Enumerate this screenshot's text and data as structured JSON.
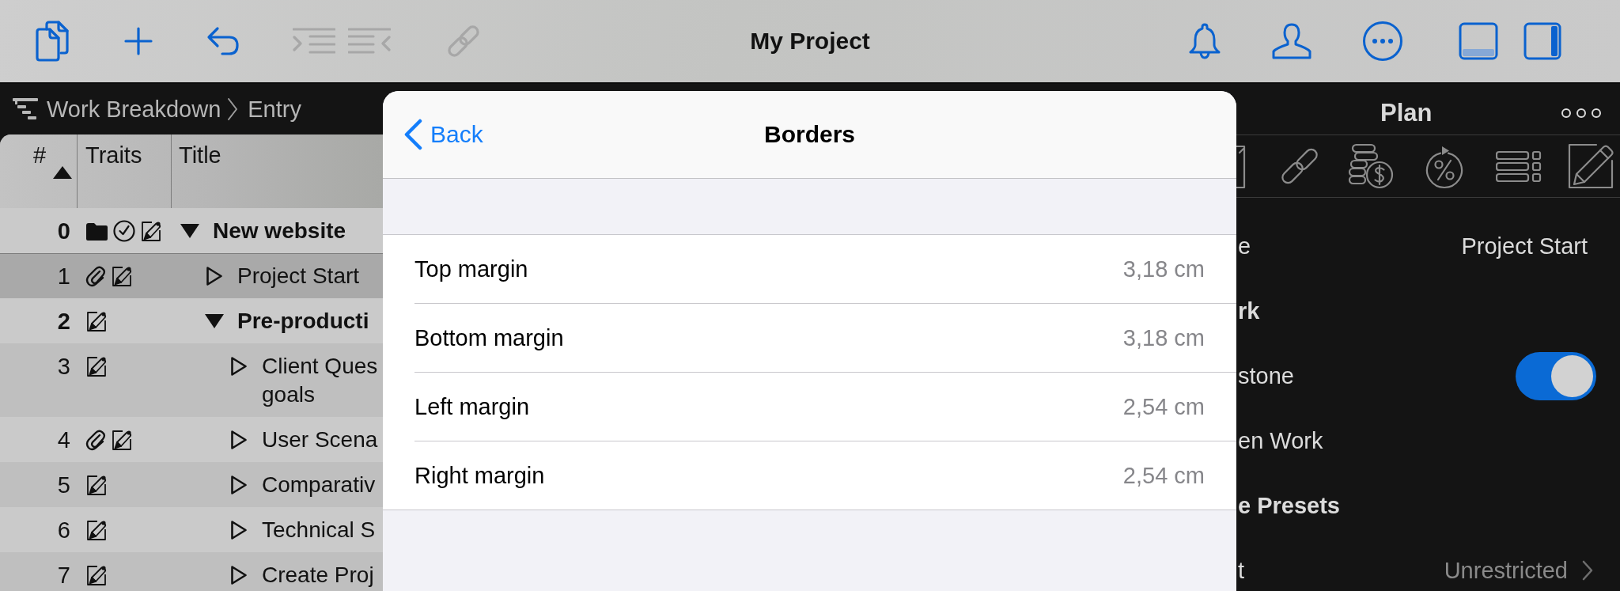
{
  "toolbar": {
    "left_buttons": [
      {
        "kind": "duplicate",
        "disabled": false
      },
      {
        "kind": "add",
        "disabled": false
      },
      {
        "kind": "undo",
        "disabled": false
      },
      {
        "kind": "indent",
        "disabled": true
      },
      {
        "kind": "outdent",
        "disabled": true
      },
      {
        "kind": "link",
        "disabled": true
      }
    ],
    "title": "My Project",
    "right_buttons": [
      {
        "kind": "notifications"
      },
      {
        "kind": "account"
      },
      {
        "kind": "more"
      }
    ],
    "view_toggles": [
      {
        "kind": "bottom_pane",
        "on": false
      },
      {
        "kind": "sidebar",
        "on": true
      }
    ]
  },
  "breadcrumb": [
    "Work Breakdown",
    "Entry"
  ],
  "table": {
    "columns": [
      {
        "label": "#",
        "sorted": true
      },
      {
        "label": "Traits",
        "sorted": false
      },
      {
        "label": "Title",
        "sorted": false
      }
    ],
    "rows": [
      {
        "number": "0",
        "title": "New website",
        "expanded": true,
        "selected": false,
        "traits": {
          "folder": true,
          "check": true,
          "attachment": false,
          "note": true
        },
        "children": [
          {
            "number": "1",
            "title": "Project Start",
            "expanded": false,
            "selected": true,
            "traits": {
              "folder": false,
              "check": false,
              "attachment": true,
              "note": true
            }
          },
          {
            "number": "2",
            "title": "Pre-producti",
            "expanded": true,
            "selected": false,
            "traits": {
              "folder": false,
              "check": false,
              "attachment": false,
              "note": true
            },
            "children": [
              {
                "number": "3",
                "title": "Client Ques\ngoals",
                "expanded": false,
                "selected": false,
                "traits": {
                  "folder": false,
                  "check": false,
                  "attachment": false,
                  "note": true
                }
              },
              {
                "number": "4",
                "title": "User Scena",
                "expanded": false,
                "selected": false,
                "traits": {
                  "folder": false,
                  "check": false,
                  "attachment": true,
                  "note": true
                }
              },
              {
                "number": "5",
                "title": "Comparativ",
                "expanded": false,
                "selected": false,
                "traits": {
                  "folder": false,
                  "check": false,
                  "attachment": false,
                  "note": true
                }
              },
              {
                "number": "6",
                "title": "Technical S",
                "expanded": false,
                "selected": false,
                "traits": {
                  "folder": false,
                  "check": false,
                  "attachment": false,
                  "note": true
                }
              },
              {
                "number": "7",
                "title": "Create Proj",
                "expanded": false,
                "selected": false,
                "traits": {
                  "folder": false,
                  "check": false,
                  "attachment": false,
                  "note": true
                }
              }
            ]
          }
        ]
      }
    ]
  },
  "dialog": {
    "back": "Back",
    "title": "Borders",
    "rows": [
      {
        "label": "Top margin",
        "value": "3,18 cm"
      },
      {
        "label": "Bottom margin",
        "value": "3,18 cm"
      },
      {
        "label": "Left margin",
        "value": "2,54 cm"
      },
      {
        "label": "Right margin",
        "value": "2,54 cm"
      }
    ]
  },
  "inspector": {
    "title": "Plan",
    "rows": [
      {
        "kind": "value",
        "label": "e",
        "value": "Project Start"
      },
      {
        "kind": "section",
        "label": "rk"
      },
      {
        "kind": "toggle",
        "label": "stone",
        "on": true
      },
      {
        "kind": "plain",
        "label": "en Work"
      },
      {
        "kind": "section",
        "label": "e Presets"
      },
      {
        "kind": "disclosure",
        "label": "t",
        "value": "Unrestricted"
      }
    ]
  }
}
